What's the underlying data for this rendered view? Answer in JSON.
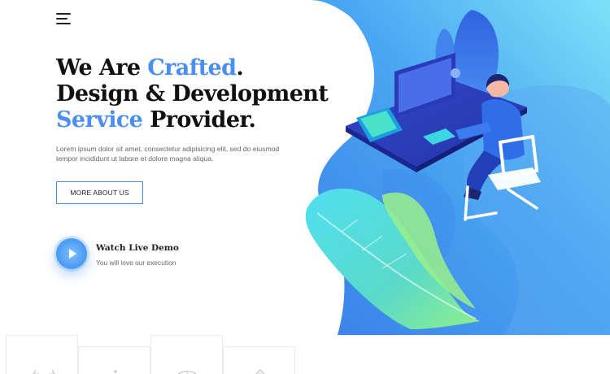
{
  "nav": {
    "menu_icon": "hamburger-menu-icon"
  },
  "hero": {
    "headline": {
      "line1_prefix": "We Are ",
      "line1_accent": "Crafted",
      "line1_suffix": ".",
      "line2": "Design & Development",
      "line3_accent": "Service",
      "line3_suffix": " Provider."
    },
    "description": "Lorem ipsum dolor sit amet, consectetur adipisicing elit, sed do eiusmod tempor incididunt ut labore et dolore magna aliqua.",
    "cta_label": "MORE ABOUT US",
    "demo": {
      "title": "Watch Live Demo",
      "subtitle": "You will love our execution",
      "icon": "play-icon"
    },
    "illustration": "developer-at-computer-illustration"
  },
  "features": {
    "icons": [
      "laptop-icon",
      "code-icon",
      "gauge-icon",
      "shield-icon"
    ]
  },
  "colors": {
    "accent": "#4a8ff0",
    "gradient_start": "#3a86ea",
    "gradient_end": "#7ce0f8",
    "text_dark": "#111111",
    "text_muted": "#666666"
  }
}
